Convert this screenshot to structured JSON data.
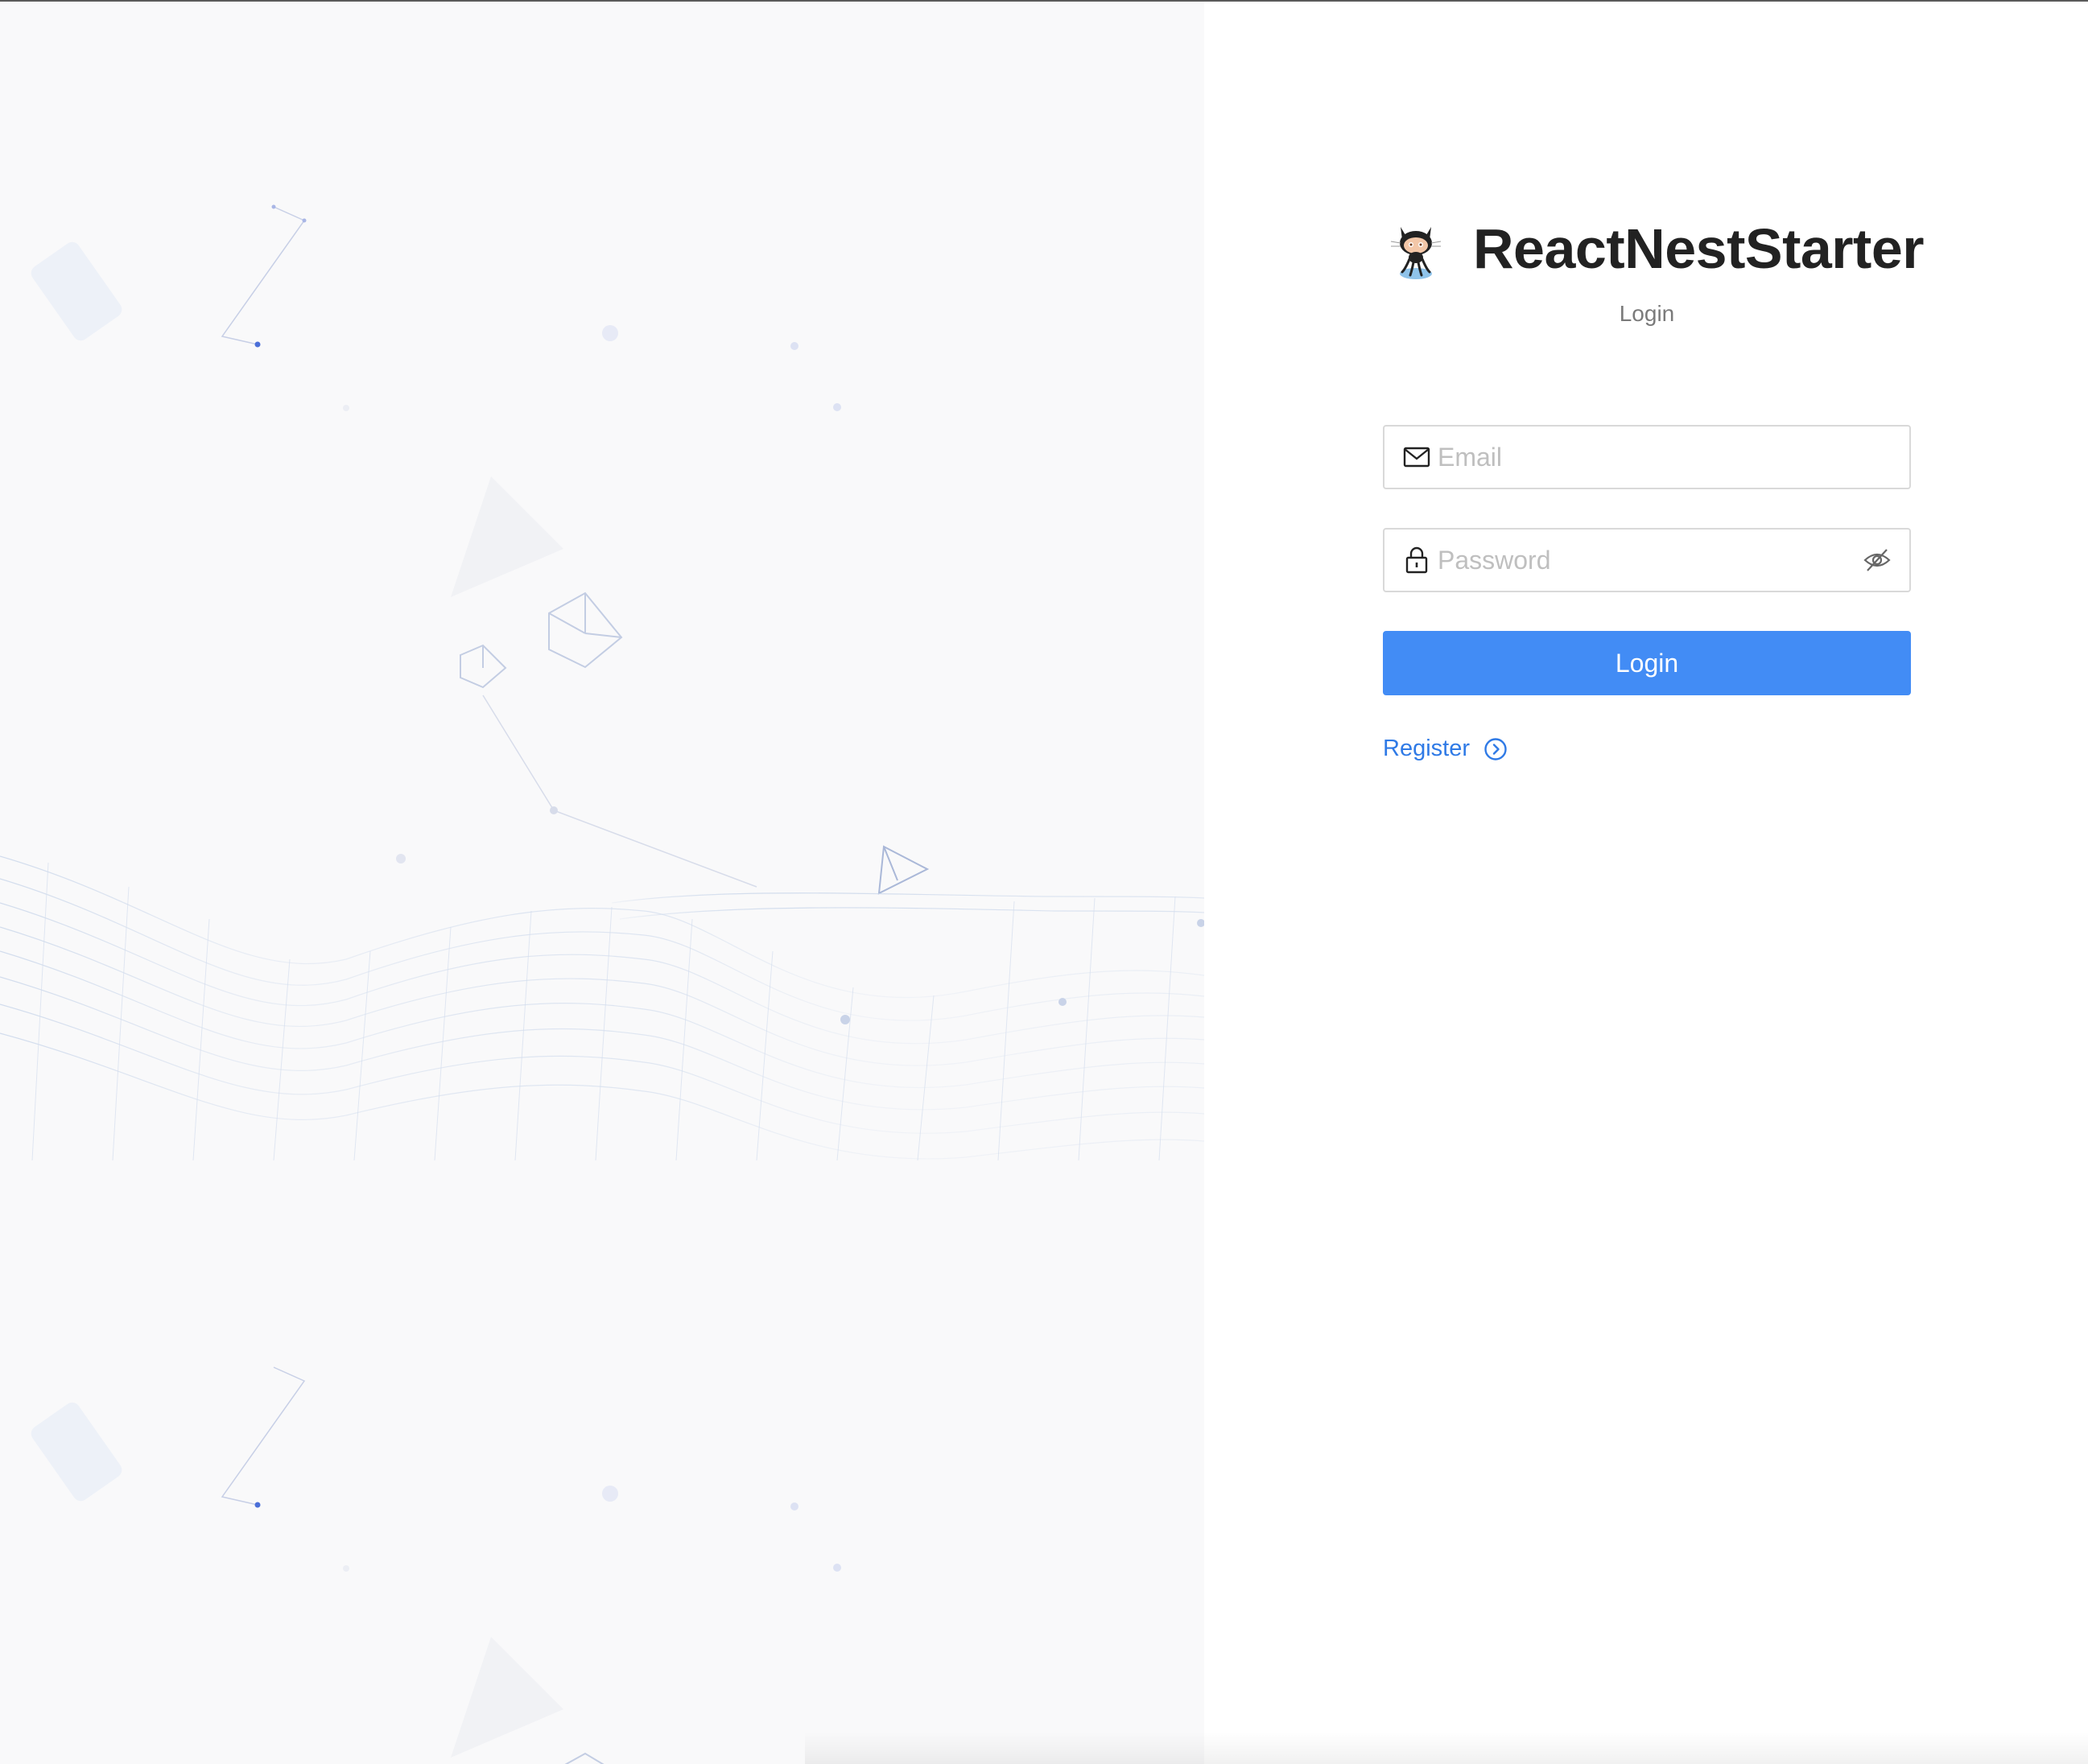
{
  "brand": {
    "title": "ReactNestStarter",
    "logo_icon": "github-octocat-icon"
  },
  "page": {
    "subtitle": "Login"
  },
  "form": {
    "email": {
      "placeholder": "Email",
      "value": "",
      "icon": "mail-icon"
    },
    "password": {
      "placeholder": "Password",
      "value": "",
      "icon": "lock-icon",
      "toggle_icon": "eye-invisible-icon"
    },
    "submit_label": "Login",
    "register_label": "Register",
    "register_icon": "right-circle-icon"
  },
  "colors": {
    "primary": "#428cf5",
    "link": "#2f7ae6",
    "left_background": "#f9f9fa",
    "right_background": "#ffffff",
    "title_text": "#222222"
  }
}
